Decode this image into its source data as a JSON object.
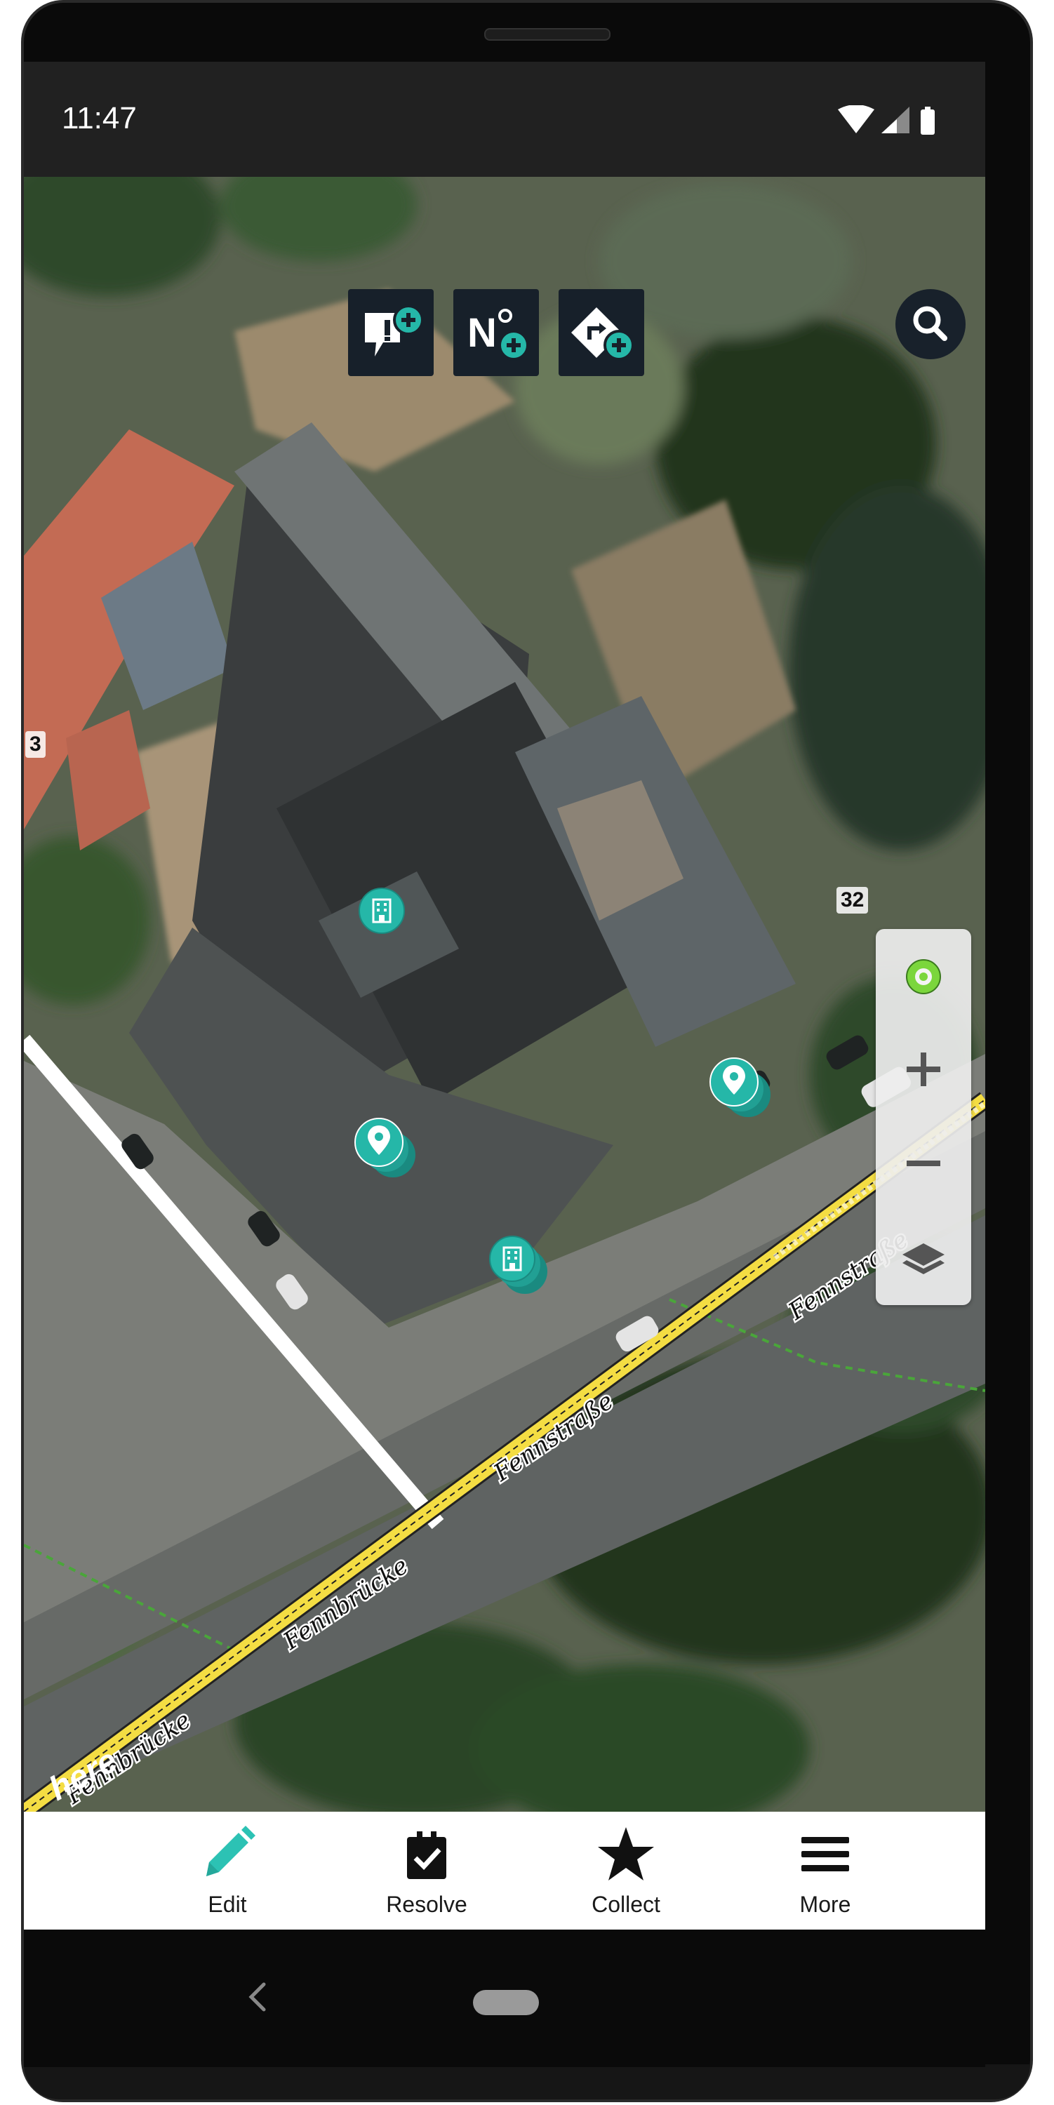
{
  "status_bar": {
    "time": "11:47",
    "icons": [
      "wifi-icon",
      "cell-signal-icon",
      "battery-icon"
    ]
  },
  "map": {
    "top_toolbar": [
      {
        "name": "add-report-button",
        "icon": "speech-bubble-plus-icon"
      },
      {
        "name": "add-house-number-button",
        "icon": "number-plus-icon"
      },
      {
        "name": "add-road-sign-button",
        "icon": "sign-plus-icon"
      }
    ],
    "search": {
      "icon": "search-icon"
    },
    "edge_labels": {
      "left": "3",
      "right": "32"
    },
    "street_labels": [
      "Fennstraße",
      "Fennstraße",
      "Fennbrücke",
      "Fennbrücke"
    ],
    "logo": "here",
    "controls": [
      "locate-icon",
      "zoom-in-icon",
      "zoom-out-icon",
      "layers-icon"
    ],
    "markers": [
      {
        "type": "building",
        "icon": "building-icon"
      },
      {
        "type": "place",
        "icon": "map-pin-icon"
      },
      {
        "type": "place",
        "icon": "map-pin-icon"
      },
      {
        "type": "building",
        "icon": "building-icon"
      }
    ],
    "colors": {
      "accent": "#25b7a8",
      "road_yellow": "#f4dd43",
      "path_green": "#4aa63a",
      "locate_green": "#7bd63c"
    }
  },
  "bottom_nav": {
    "items": [
      {
        "label": "Edit",
        "icon": "pencil-icon",
        "active": true
      },
      {
        "label": "Resolve",
        "icon": "clipboard-check-icon"
      },
      {
        "label": "Collect",
        "icon": "star-icon"
      },
      {
        "label": "More",
        "icon": "menu-icon"
      }
    ]
  }
}
